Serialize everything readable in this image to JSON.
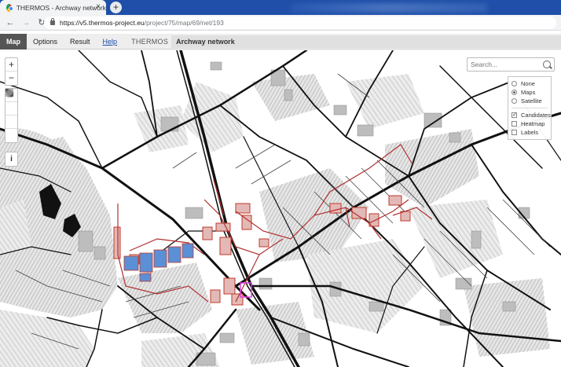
{
  "browser": {
    "tab_title": "THERMOS - Archway network",
    "close_glyph": "×",
    "new_tab_glyph": "+",
    "url_host": "https://v5.thermos-project.eu",
    "url_path": "/project/75/map/69/net/193"
  },
  "appbar": {
    "tabs": [
      {
        "label": "Map",
        "active": true
      },
      {
        "label": "Options"
      },
      {
        "label": "Result"
      },
      {
        "label": "Help",
        "link": true
      }
    ],
    "brand": "THERMOS",
    "network_name": "Archway network"
  },
  "map": {
    "controls": {
      "zoom_in": "+",
      "zoom_out": "−",
      "info": "i"
    },
    "search": {
      "placeholder": "Search...",
      "icon": "search-icon"
    },
    "layers": {
      "basemap": [
        {
          "label": "None",
          "selected": false
        },
        {
          "label": "Maps",
          "selected": true
        },
        {
          "label": "Satellite",
          "selected": false
        }
      ],
      "overlays": [
        {
          "label": "Candidates",
          "checked": true
        },
        {
          "label": "Heatmap",
          "checked": false
        },
        {
          "label": "Labels",
          "checked": false
        }
      ]
    },
    "colors": {
      "road": "#111111",
      "building": "#bdbdbd",
      "candidate_outline": "#c0392b",
      "network_line": "#b03030",
      "selected_building_fill": "#5b8fd6",
      "magenta_highlight": "#e040e0"
    }
  }
}
